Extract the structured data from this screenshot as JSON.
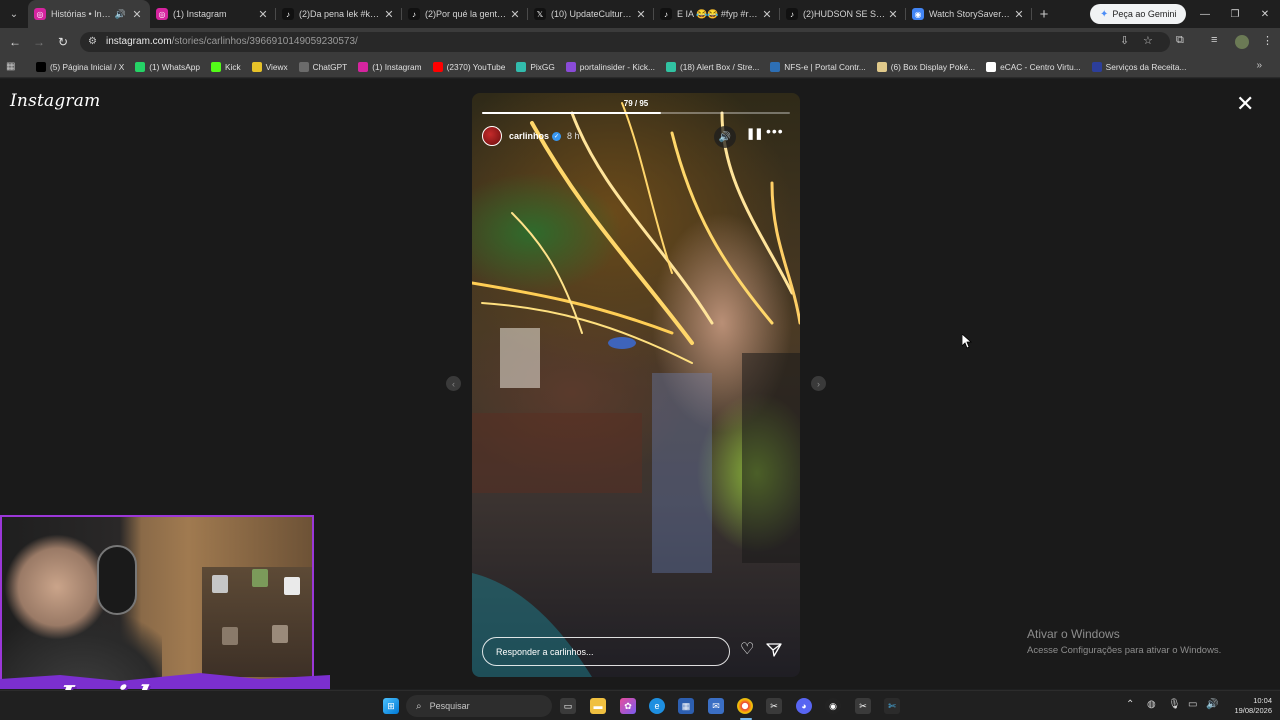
{
  "browser": {
    "tabs": [
      {
        "title": "Histórias • Instagram",
        "favicon": "instagram",
        "color": "#d6249f",
        "active": true,
        "audio": true
      },
      {
        "title": "(1) Instagram",
        "favicon": "instagram",
        "color": "#d6249f"
      },
      {
        "title": "(2)Da pena lek #koskylol",
        "favicon": "tiktok",
        "color": "#111111"
      },
      {
        "title": "(2)Por qué la gente lo",
        "favicon": "tiktok",
        "color": "#111111"
      },
      {
        "title": "(10) UpdateCultura no",
        "favicon": "x",
        "color": "#111111"
      },
      {
        "title": "E IA 😂😂 #fyp #reels",
        "favicon": "tiktok",
        "color": "#111111"
      },
      {
        "title": "(2)HUDSON SE SURPR",
        "favicon": "tiktok",
        "color": "#111111"
      },
      {
        "title": "Watch StorySaver.net",
        "favicon": "storysaver",
        "color": "#4285f4"
      }
    ],
    "gemini_label": "Peça ao Gemini",
    "url_host": "instagram.com",
    "url_path": "/stories/carlinhos/3966910149059230573/",
    "bookmarks": [
      {
        "label": "(5) Página Inicial / X",
        "icon": "x-icon",
        "color": "#000000"
      },
      {
        "label": "(1) WhatsApp",
        "icon": "whatsapp-icon",
        "color": "#25d366"
      },
      {
        "label": "Kick",
        "icon": "kick-icon",
        "color": "#53fc18"
      },
      {
        "label": "Viewx",
        "icon": "viewx-icon",
        "color": "#e6c229"
      },
      {
        "label": "ChatGPT",
        "icon": "chatgpt-icon",
        "color": "#6b6b6b"
      },
      {
        "label": "(1) Instagram",
        "icon": "instagram-icon",
        "color": "#d6249f"
      },
      {
        "label": "(2370) YouTube",
        "icon": "youtube-icon",
        "color": "#ff0000"
      },
      {
        "label": "PixGG",
        "icon": "pixgg-icon",
        "color": "#32bcad"
      },
      {
        "label": "portalinsider - Kick...",
        "icon": "portalinsider-icon",
        "color": "#8a4bd8"
      },
      {
        "label": "(18) Alert Box / Stre...",
        "icon": "alertbox-icon",
        "color": "#31c3a2"
      },
      {
        "label": "NFS-e | Portal Contr...",
        "icon": "nfse-icon",
        "color": "#2d6fb5"
      },
      {
        "label": "(6) Box Display Poké...",
        "icon": "pokemon-icon",
        "color": "#e0c98a"
      },
      {
        "label": "eCAC - Centro Virtu...",
        "icon": "ecac-icon",
        "color": "#ffffff"
      },
      {
        "label": "Serviços da Receita...",
        "icon": "receita-icon",
        "color": "#2c3e9a"
      }
    ]
  },
  "instagram": {
    "logo": "Instagram",
    "story": {
      "counter": "79 / 95",
      "progress": 0.58,
      "username": "carlinhos",
      "time": "8 h",
      "reply_placeholder": "Responder a carlinhos..."
    }
  },
  "overlay": {
    "brand": "Insider",
    "activate_title": "Ativar o Windows",
    "activate_sub": "Acesse Configurações para ativar o Windows."
  },
  "taskbar": {
    "search_placeholder": "Pesquisar",
    "time": "10:04",
    "date": "19/08/2026"
  },
  "colors": {
    "accent": "#9b37d8",
    "verified": "#3897f0"
  }
}
